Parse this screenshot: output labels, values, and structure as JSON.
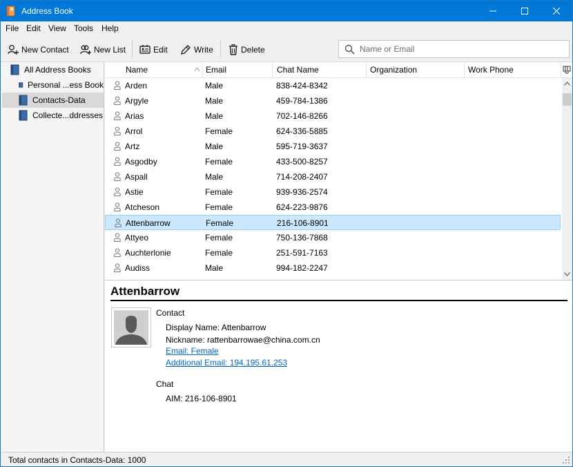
{
  "window": {
    "title": "Address Book"
  },
  "menu": [
    "File",
    "Edit",
    "View",
    "Tools",
    "Help"
  ],
  "toolbar": {
    "new_contact": "New Contact",
    "new_list": "New List",
    "edit": "Edit",
    "write": "Write",
    "delete": "Delete",
    "search_placeholder": "Name or Email"
  },
  "sidebar": {
    "items": [
      {
        "label": "All Address Books",
        "selected": false
      },
      {
        "label": "Personal ...ess Book",
        "selected": false
      },
      {
        "label": "Contacts-Data",
        "selected": true
      },
      {
        "label": "Collecte...ddresses",
        "selected": false
      }
    ]
  },
  "list": {
    "columns": [
      "Name",
      "Email",
      "Chat Name",
      "Organization",
      "Work Phone"
    ],
    "sort_column": "Name",
    "sort_direction": "ascending",
    "rows": [
      {
        "name": "Arden",
        "email": "Male",
        "chat": "838-424-8342"
      },
      {
        "name": "Argyle",
        "email": "Male",
        "chat": "459-784-1386"
      },
      {
        "name": "Arias",
        "email": "Male",
        "chat": "702-146-8266"
      },
      {
        "name": "Arrol",
        "email": "Female",
        "chat": "624-336-5885"
      },
      {
        "name": "Artz",
        "email": "Male",
        "chat": "595-719-3637"
      },
      {
        "name": "Asgodby",
        "email": "Female",
        "chat": "433-500-8257"
      },
      {
        "name": "Aspall",
        "email": "Male",
        "chat": "714-208-2407"
      },
      {
        "name": "Astie",
        "email": "Female",
        "chat": "939-936-2574"
      },
      {
        "name": "Atcheson",
        "email": "Female",
        "chat": "624-223-9876"
      },
      {
        "name": "Attenbarrow",
        "email": "Female",
        "chat": "216-106-8901",
        "selected": true
      },
      {
        "name": "Attyeo",
        "email": "Female",
        "chat": "750-136-7868"
      },
      {
        "name": "Auchterlonie",
        "email": "Female",
        "chat": "251-591-7163"
      },
      {
        "name": "Audiss",
        "email": "Male",
        "chat": "994-182-2247"
      }
    ]
  },
  "detail": {
    "name": "Attenbarrow",
    "contact_section": "Contact",
    "display_name": "Display Name: Attenbarrow",
    "nickname": "Nickname: rattenbarrowae@china.com.cn",
    "email": "Email: Female",
    "additional_email": "Additional Email: 194.195.61.253",
    "chat_section": "Chat",
    "aim": "AIM: 216-106-8901"
  },
  "status": {
    "text": "Total contacts in Contacts-Data: 1000"
  },
  "colors": {
    "titlebar": "#0078d7",
    "selection": "#cce8ff",
    "link": "#0066cc"
  }
}
